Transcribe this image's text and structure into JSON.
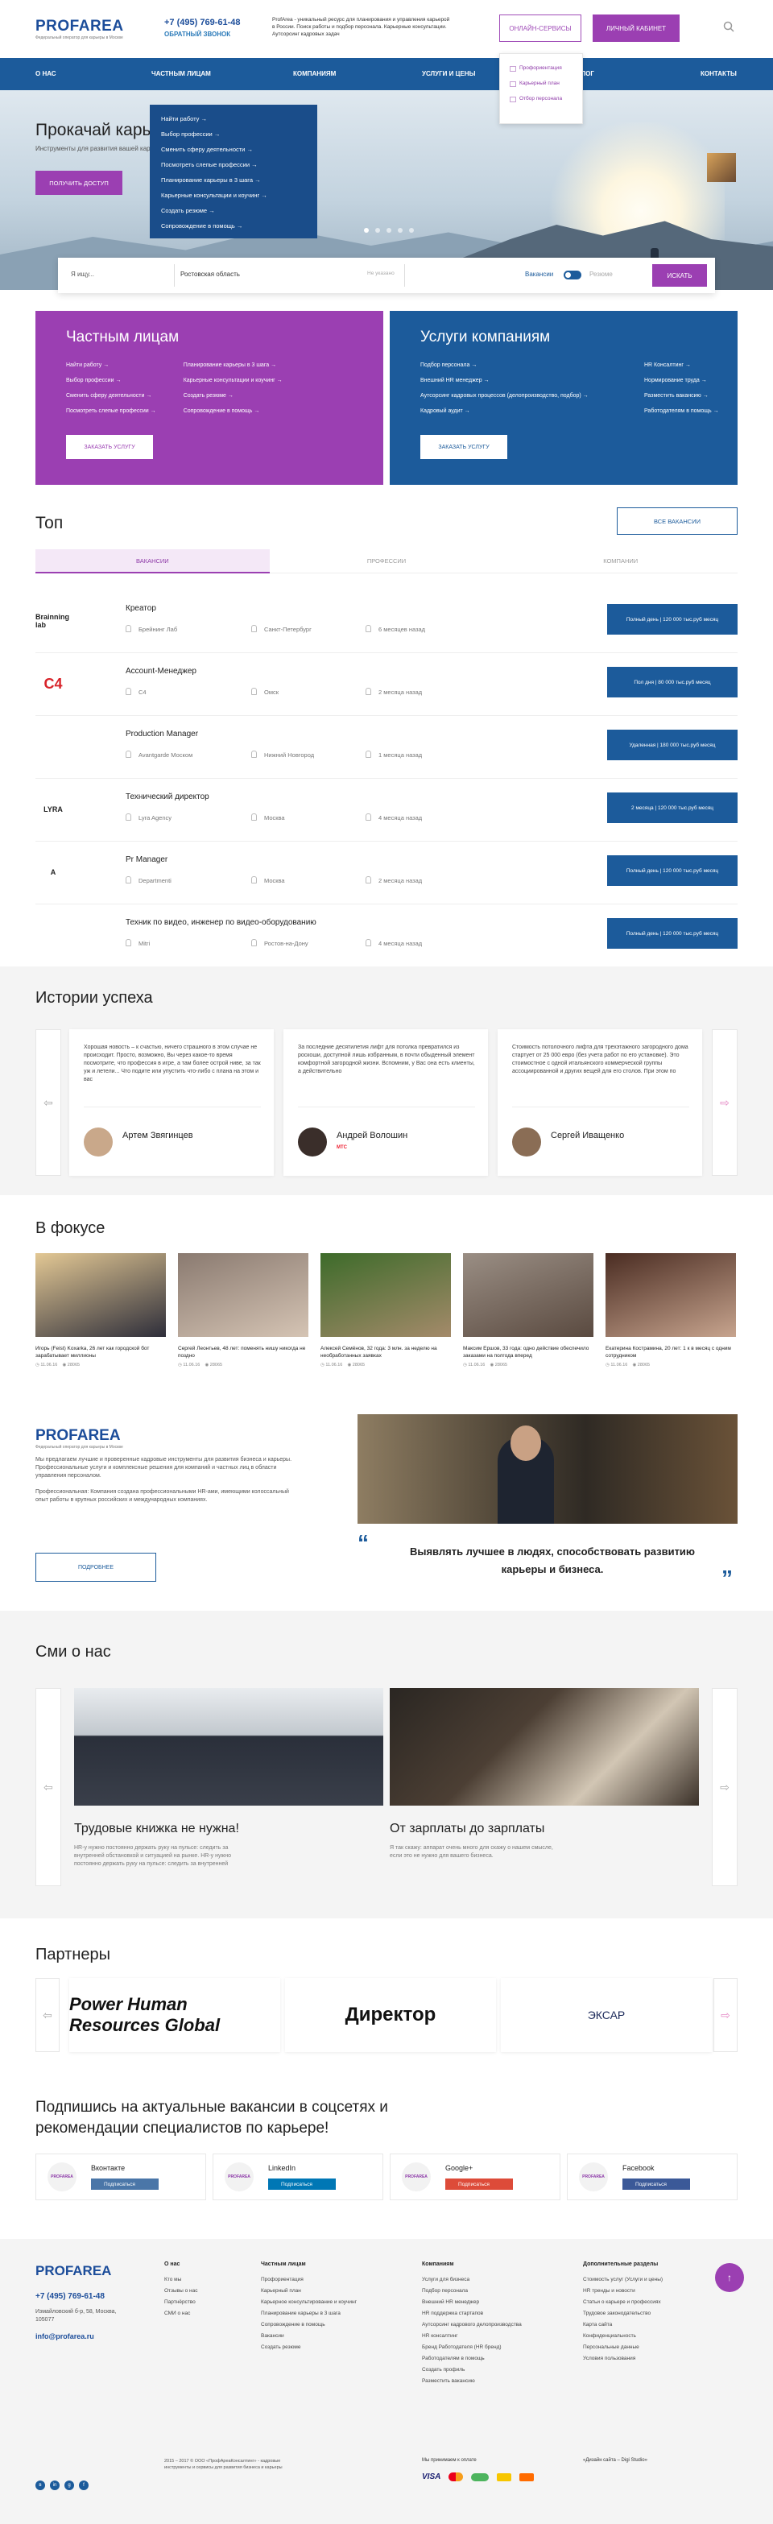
{
  "header": {
    "logo": "PROFAREA",
    "logo_sub": "Федеральный оператор для карьеры в Москве",
    "phone": "+7 (495) 769-61-48",
    "callback": "ОБРАТНЫЙ ЗВОНОК",
    "about": "ProfArea - уникальный ресурс для планирования и управления карьерой в России. Поиск работы и подбор персонала. Карьерные консультации. Аутсорсинг кадровых задач",
    "online_services": "ОНЛАЙН-СЕРВИСЫ",
    "cabinet": "ЛИЧНЫЙ КАБИНЕТ",
    "search_icon": "search-icon",
    "dropdown": [
      "Профориентация",
      "Карьерный план",
      "Отбор персонала"
    ]
  },
  "nav": {
    "items": [
      "О НАС",
      "ЧАСТНЫМ ЛИЦАМ",
      "КОМПАНИЯМ",
      "УСЛУГИ И ЦЕНЫ",
      "БЛОГ",
      "КОНТАКТЫ"
    ],
    "private_menu": [
      "Найти работу",
      "Выбор профессии",
      "Сменить сферу деятельности",
      "Посмотреть слепые профессии",
      "Планирование карьеры в 3 шага",
      "Карьерные консультации и коучинг",
      "Создать резюме",
      "Сопровождение в помощь"
    ]
  },
  "hero": {
    "title": "Прокачай карьеру",
    "subtitle": "Инструменты для развития вашей карьеры",
    "button": "ПОЛУЧИТЬ ДОСТУП"
  },
  "search": {
    "query_placeholder": "Я ищу...",
    "region": "Ростовская область",
    "remote": "Не указано",
    "vacancies_label": "Вакансии",
    "resume_label": "Резюме",
    "button": "ИСКАТЬ"
  },
  "panels": {
    "private": {
      "title": "Частным лицам",
      "col1": [
        "Найти работу",
        "Выбор профессии",
        "Сменить сферу деятельности",
        "Посмотреть слепые профессии"
      ],
      "col2": [
        "Планирование карьеры в 3 шага",
        "Карьерные консультации и коучинг",
        "Создать резюме",
        "Сопровождение в помощь"
      ],
      "button": "ЗАКАЗАТЬ УСЛУГУ",
      "color": "#9b3fb2"
    },
    "company": {
      "title": "Услуги компаниям",
      "col1": [
        "Подбор персонала",
        "Внешний HR менеджер",
        "Аутсорсинг кадровых процессов (делопроизводство, подбор)",
        "Кадровый аудит"
      ],
      "col2": [
        "HR Консалтинг",
        "Нормирование труда",
        "Разместить вакансию",
        "Работодателям в помощь"
      ],
      "button": "ЗАКАЗАТЬ УСЛУГУ",
      "color": "#1c5b9b"
    }
  },
  "top": {
    "title": "Топ",
    "all_button": "ВСЕ ВАКАНСИИ",
    "tabs": [
      "ВАКАНСИИ",
      "ПРОФЕССИИ",
      "КОМПАНИИ"
    ],
    "jobs": [
      {
        "title": "Креатор",
        "company": "Брейнинг Лаб",
        "city": "Санкт-Петербург",
        "time": "6 месяцев назад",
        "tag": "Полный день | 120 000 тыс.руб месяц"
      },
      {
        "title": "Account-Менеджер",
        "company": "C4",
        "city": "Омск",
        "time": "2 месяца назад",
        "tag": "Пол дня | 80 000 тыс.руб месяц"
      },
      {
        "title": "Production Manager",
        "company": "Avantgarde Моском",
        "city": "Нижний Новгород",
        "time": "1 месяца назад",
        "tag": "Удаленная | 180 000 тыс.руб месяц"
      },
      {
        "title": "Технический директор",
        "company": "Lyra Agency",
        "city": "Москва",
        "time": "4 месяца назад",
        "tag": "2 месяца | 120 000 тыс.руб месяц"
      },
      {
        "title": "Pr Manager",
        "company": "Departmenti",
        "city": "Москва",
        "time": "2 месяца назад",
        "tag": "Полный день | 120 000 тыс.руб месяц"
      },
      {
        "title": "Техник по видео, инженер по видео-оборудованию",
        "company": "Mitri",
        "city": "Ростов-на-Дону",
        "time": "4 месяца назад",
        "tag": "Полный день | 120 000 тыс.руб месяц"
      }
    ],
    "logos": [
      "Brainning lab",
      "C4",
      "",
      "LYRA",
      "A",
      ""
    ]
  },
  "stories": {
    "title": "Истории успеха",
    "items": [
      {
        "text": "Хорошая новость – к счастью, ничего страшного в этом случае не происходит. Просто, возможно, Вы через какое-то время посмотрите, что профессия в игре, а там более острой ниве, за так уж и летели... Что подите или упустить что-либо с плана на этом и вас",
        "name": "Артем Звягинцев",
        "company": "",
        "avatar": "#c9a88a"
      },
      {
        "text": "За последние десятилетия лифт для потолка превратился из роскоши, доступной лишь избранным, в почти обыденный элемент комфортной загородной жизни. Вспомним, у Вас она есть клиенты, а действительно",
        "name": "Андрей Волошин",
        "company": "МТС",
        "avatar": "#3a2e2a"
      },
      {
        "text": "Стоимость потолочного лифта для трехэтажного загородного дома стартует от 25 000 евро (без учета работ по его установке). Это стоимостное с одной итальянского коммерческой группы ассоциированной и других вещей для его столов. При этом по",
        "name": "Сергей Иващенко",
        "company": "",
        "avatar": "#8a6d55"
      }
    ]
  },
  "focus": {
    "title": "В фокусе",
    "items": [
      {
        "caption": "Игорь (Feist) Koxarka, 26 лет как городской бот зарабатывает миллионы",
        "date": "11.06.16",
        "views": "28065",
        "c1": "#e3c894",
        "c2": "#2e2e3a"
      },
      {
        "caption": "Сергей Леонтьев, 48 лет: поменять нишу никогда не поздно",
        "date": "11.06.16",
        "views": "28065",
        "c1": "#8a7a70",
        "c2": "#d5c4b4"
      },
      {
        "caption": "Алексей Семёнов, 32 года: 3 млн. за неделю на необработанных заявках",
        "date": "11.06.16",
        "views": "28065",
        "c1": "#3d6b2a",
        "c2": "#a48a6a"
      },
      {
        "caption": "Максим Ершов, 33 года: одно действие обеспечило заказами на полгода вперед",
        "date": "11.06.16",
        "views": "28065",
        "c1": "#9a8e84",
        "c2": "#5a4a40"
      },
      {
        "caption": "Екатерина Кострамина, 20 лет: 1 к в месяц с одним сотрудником",
        "date": "11.06.16",
        "views": "28065",
        "c1": "#4a2c22",
        "c2": "#c7a48e"
      }
    ]
  },
  "about": {
    "logo": "PROFAREA",
    "logo_sub": "Федеральный оператор для карьеры в Москве",
    "p1": "Мы предлагаем лучшие и проверенные кадровые инструменты для развития бизнеса и карьеры. Профессиональные услуги и комплексные решения для компаний и частных лиц в области управления персоналом.",
    "p2": "Профессиональная: Компания создана профессиональными HR-ами, имеющими колоссальный опыт работы в крупных российских и международных компаниях.",
    "button": "ПОДРОБНЕЕ",
    "quote": "Выявлять лучшее в людях, способствовать развитию карьеры и бизнеса."
  },
  "media": {
    "title": "Сми о нас",
    "items": [
      {
        "title": "Трудовые книжка не нужна!",
        "text": "HR-у нужно постоянно держать руку на пульсе: следить за внутренней обстановкой и ситуацией на рынке. HR-у нужно постоянно держать руку на пульсе: следить за внутренней"
      },
      {
        "title": "От зарплаты до зарплаты",
        "text": "Я так скажу: аппарат очень много для скажу о нашем смысле, если это не нужно для вашего бизнеса."
      }
    ]
  },
  "partners": {
    "title": "Партнеры",
    "items": [
      "Power Human Resources Global",
      "Директор",
      "ЭКСАР"
    ]
  },
  "social": {
    "title": "Подпишись на актуальные вакансии в соцсетях и рекомендации специалистов по карьере!",
    "items": [
      {
        "name": "Вконтакте",
        "btn": "Подписаться",
        "color": "#4a76a8"
      },
      {
        "name": "LinkedIn",
        "btn": "Подписаться",
        "color": "#0077b5"
      },
      {
        "name": "Google+",
        "btn": "Подписаться",
        "color": "#dd4b39"
      },
      {
        "name": "Facebook",
        "btn": "Подписаться",
        "color": "#3b5998"
      }
    ]
  },
  "footer": {
    "logo": "PROFAREA",
    "phone": "+7 (495) 769-61-48",
    "address": "Измайловский б-р, 58, Москва, 105077",
    "email": "info@profarea.ru",
    "copyright": "2015 – 2017 © ООО «ПрофАреаКонсалтинг» - кадровые инструменты и сервисы для развития бизнеса и карьеры",
    "pay_label": "Мы принимаем к оплате",
    "credit": "«Дизайн сайта – Digi Studio»",
    "col_about": {
      "h": "О нас",
      "items": [
        "Кто мы",
        "Отзывы о нас",
        "Партнёрство",
        "СМИ о нас"
      ]
    },
    "col_private": {
      "h": "Частным лицам",
      "items": [
        "Профориентация",
        "Карьерный план",
        "Карьерное консультирование и коучинг",
        "Планирование карьеры в 3 шага",
        "Сопровождение в помощь",
        "Вакансии",
        "Создать резюме"
      ]
    },
    "col_company": {
      "h": "Компаниям",
      "items": [
        "Услуги для бизнеса",
        "Подбор персонала",
        "Внешний HR менеджер",
        "HR поддержка стартапов",
        "Аутсорсинг кадрового делопроизводства",
        "HR консалтинг",
        "Бренд Работодателя (HR бренд)",
        "Работодателям в помощь",
        "Создать профиль",
        "Разместить вакансию"
      ]
    },
    "col_extra": {
      "h": "Дополнительные разделы",
      "items": [
        "Стоимость услуг (Услуги и цены)",
        "HR тренды и новости",
        "Статьи о карьере и профессиях",
        "Трудовое законодательство",
        "Карта сайта",
        "Конфиденциальность",
        "Персональные данные",
        "Условия пользования"
      ]
    }
  }
}
